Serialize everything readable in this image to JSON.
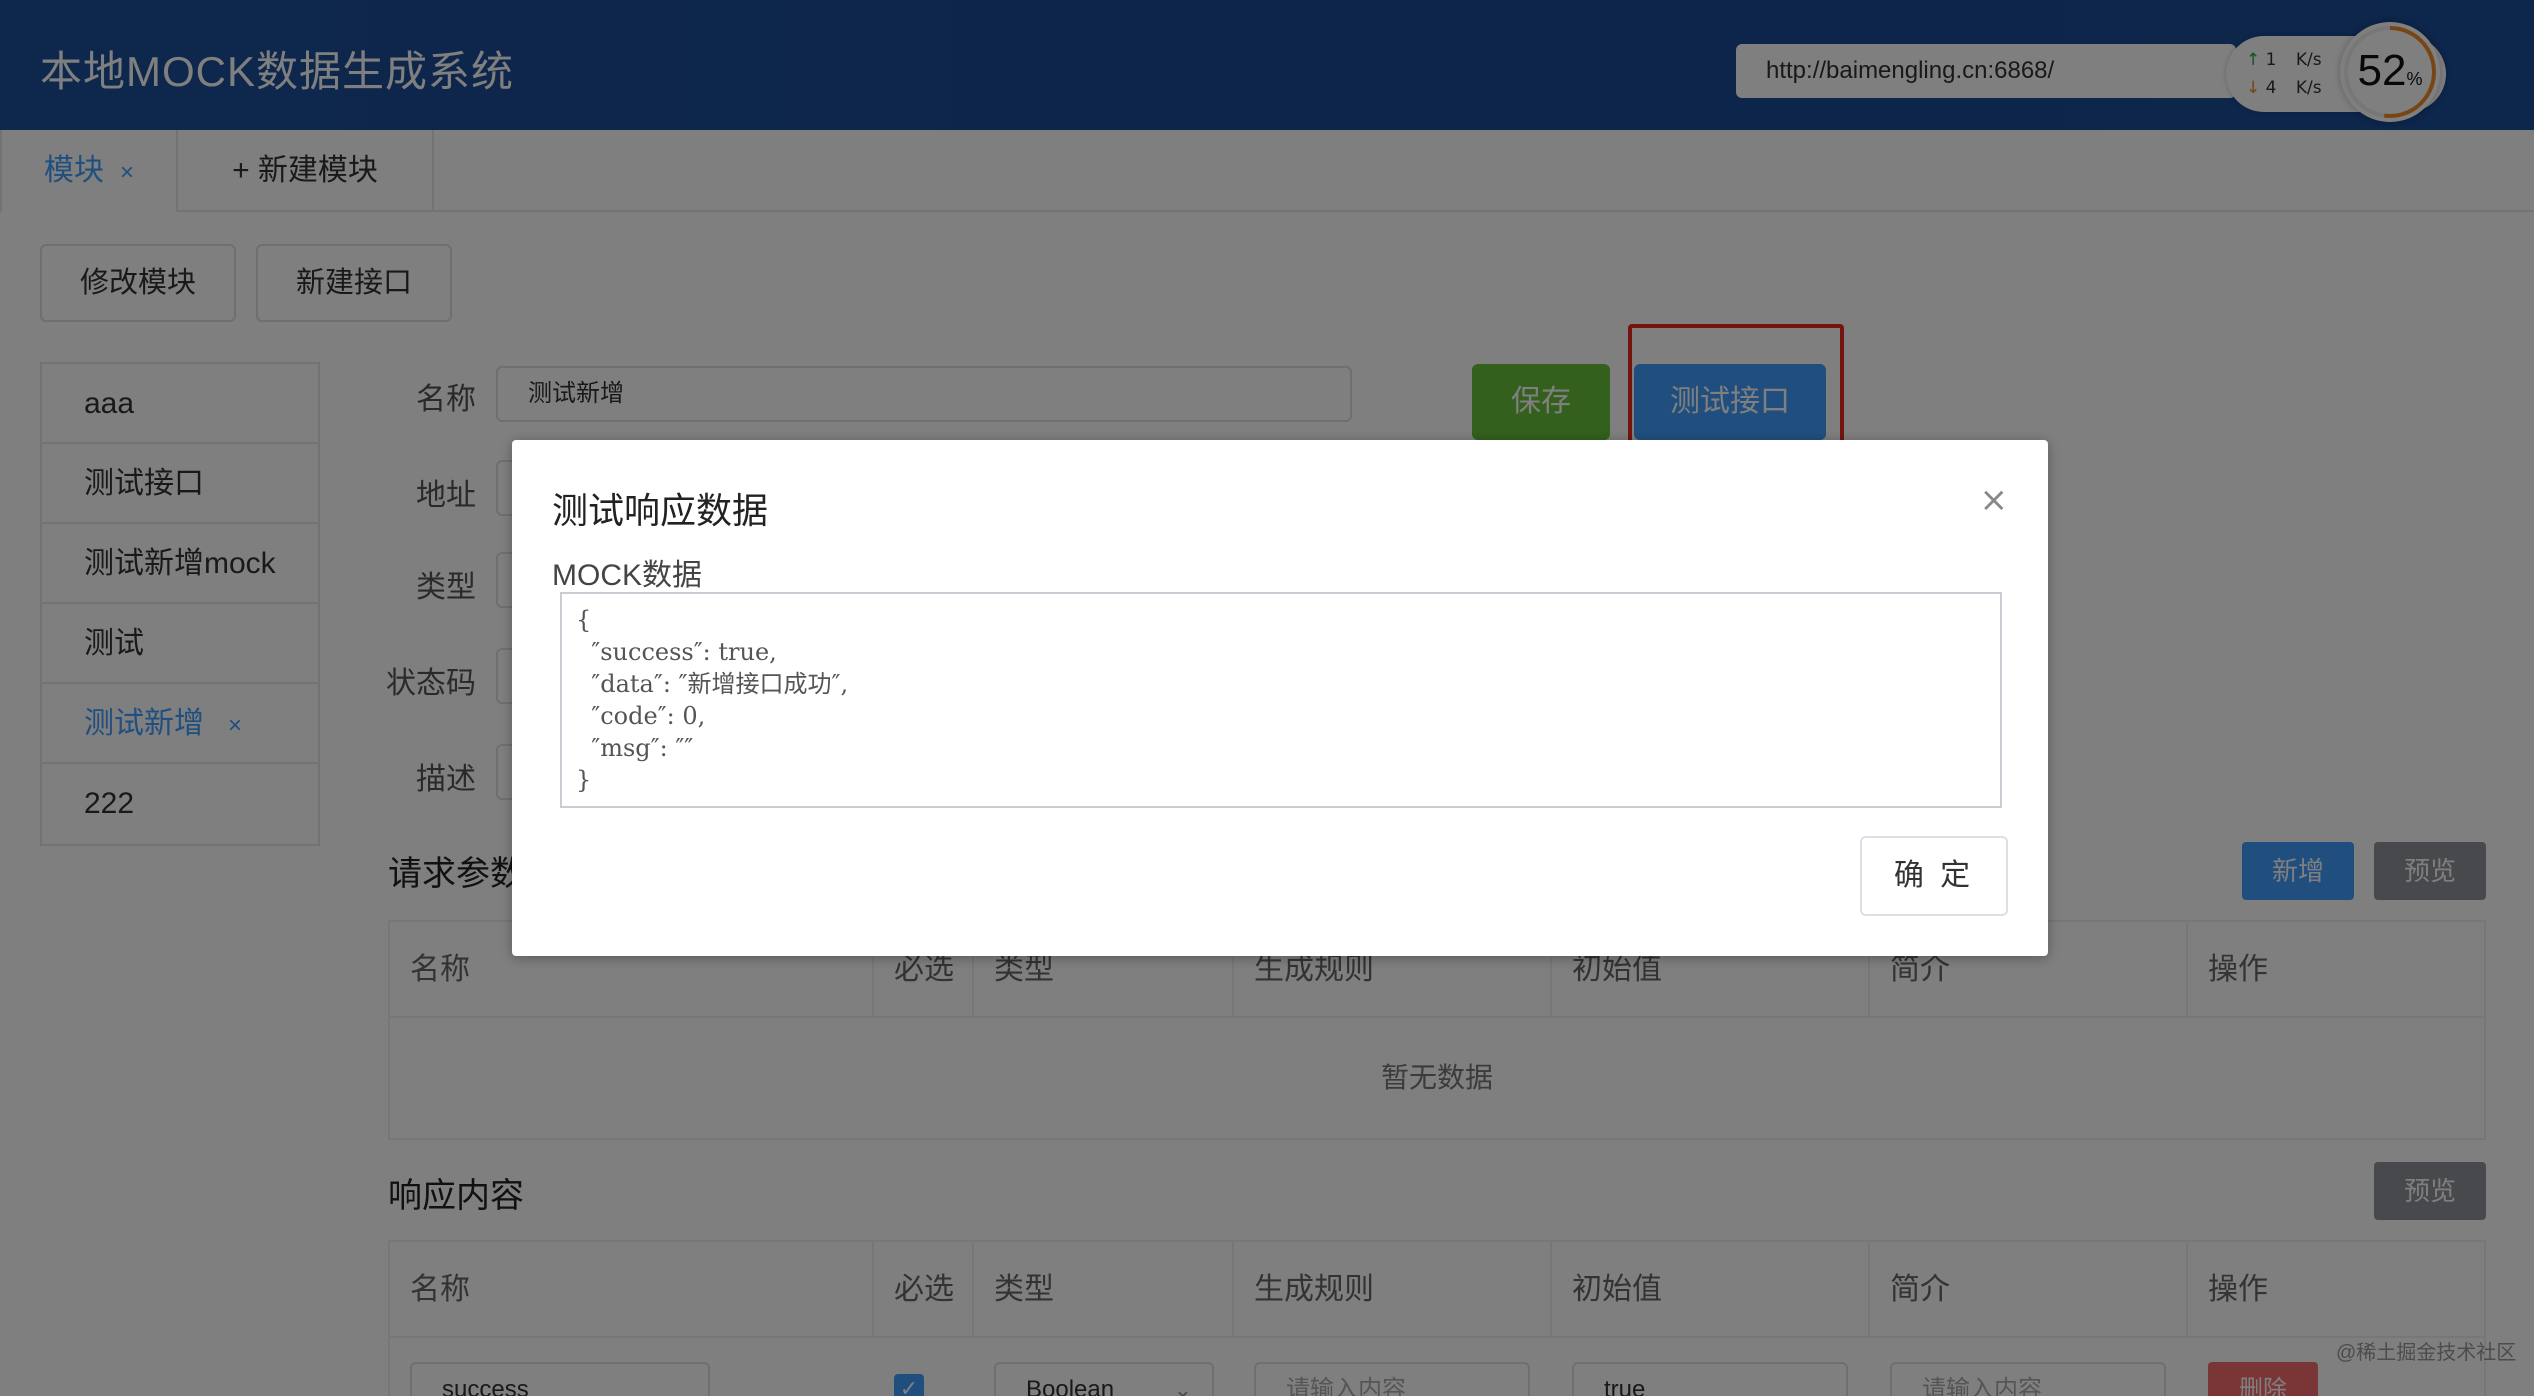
{
  "header": {
    "title": "本地MOCK数据生成系统",
    "url": "http://baimengling.cn:6868/"
  },
  "network": {
    "up_value": "1",
    "down_value": "4",
    "unit": "K/s",
    "percent": "52",
    "percent_sign": "%"
  },
  "tabs": {
    "active_label": "模块",
    "close_glyph": "×",
    "new_label": "+ 新建模块"
  },
  "toolbar": {
    "edit_module": "修改模块",
    "new_interface": "新建接口"
  },
  "sidebar": {
    "items": [
      {
        "label": "aaa"
      },
      {
        "label": "测试接口"
      },
      {
        "label": "测试新增mock"
      },
      {
        "label": "测试"
      },
      {
        "label": "测试新增"
      },
      {
        "label": "222"
      }
    ],
    "close_glyph": "×"
  },
  "form": {
    "name_label": "名称",
    "name_value": "测试新增",
    "address_label": "地址",
    "type_label": "类型",
    "status_label": "状态码",
    "desc_label": "描述",
    "save_label": "保存",
    "test_label": "测试接口"
  },
  "request_params": {
    "title": "请求参数",
    "add_label": "新增",
    "preview_label": "预览",
    "columns": [
      "名称",
      "必选",
      "类型",
      "生成规则",
      "初始值",
      "简介",
      "操作"
    ],
    "empty_text": "暂无数据"
  },
  "response": {
    "title": "响应内容",
    "preview_label": "预览",
    "columns": [
      "名称",
      "必选",
      "类型",
      "生成规则",
      "初始值",
      "简介",
      "操作"
    ],
    "row": {
      "name": "success",
      "checked": "✓",
      "type": "Boolean",
      "rule_placeholder": "请输入内容",
      "initial": "true",
      "desc_placeholder": "请输入内容",
      "delete_label": "删除"
    }
  },
  "modal": {
    "title": "测试响应数据",
    "close_glyph": "×",
    "label": "MOCK数据",
    "json_text": "{\n  ″success″: true,\n  ″data″: ″新增接口成功″,\n  ″code″: 0,\n  ″msg″: ″″\n}",
    "ok_label": "确 定"
  },
  "watermark": "@稀土掘金技术社区",
  "colors": {
    "header_bg": "#1d4f9a",
    "primary": "#409eff",
    "success": "#67c23a",
    "danger": "#f56c6c",
    "highlight": "#e8281c"
  },
  "icons": {
    "up_arrow": "arrow-up-icon",
    "down_arrow": "arrow-down-icon",
    "close": "close-icon",
    "chevron": "chevron-down-icon",
    "check": "check-icon"
  }
}
